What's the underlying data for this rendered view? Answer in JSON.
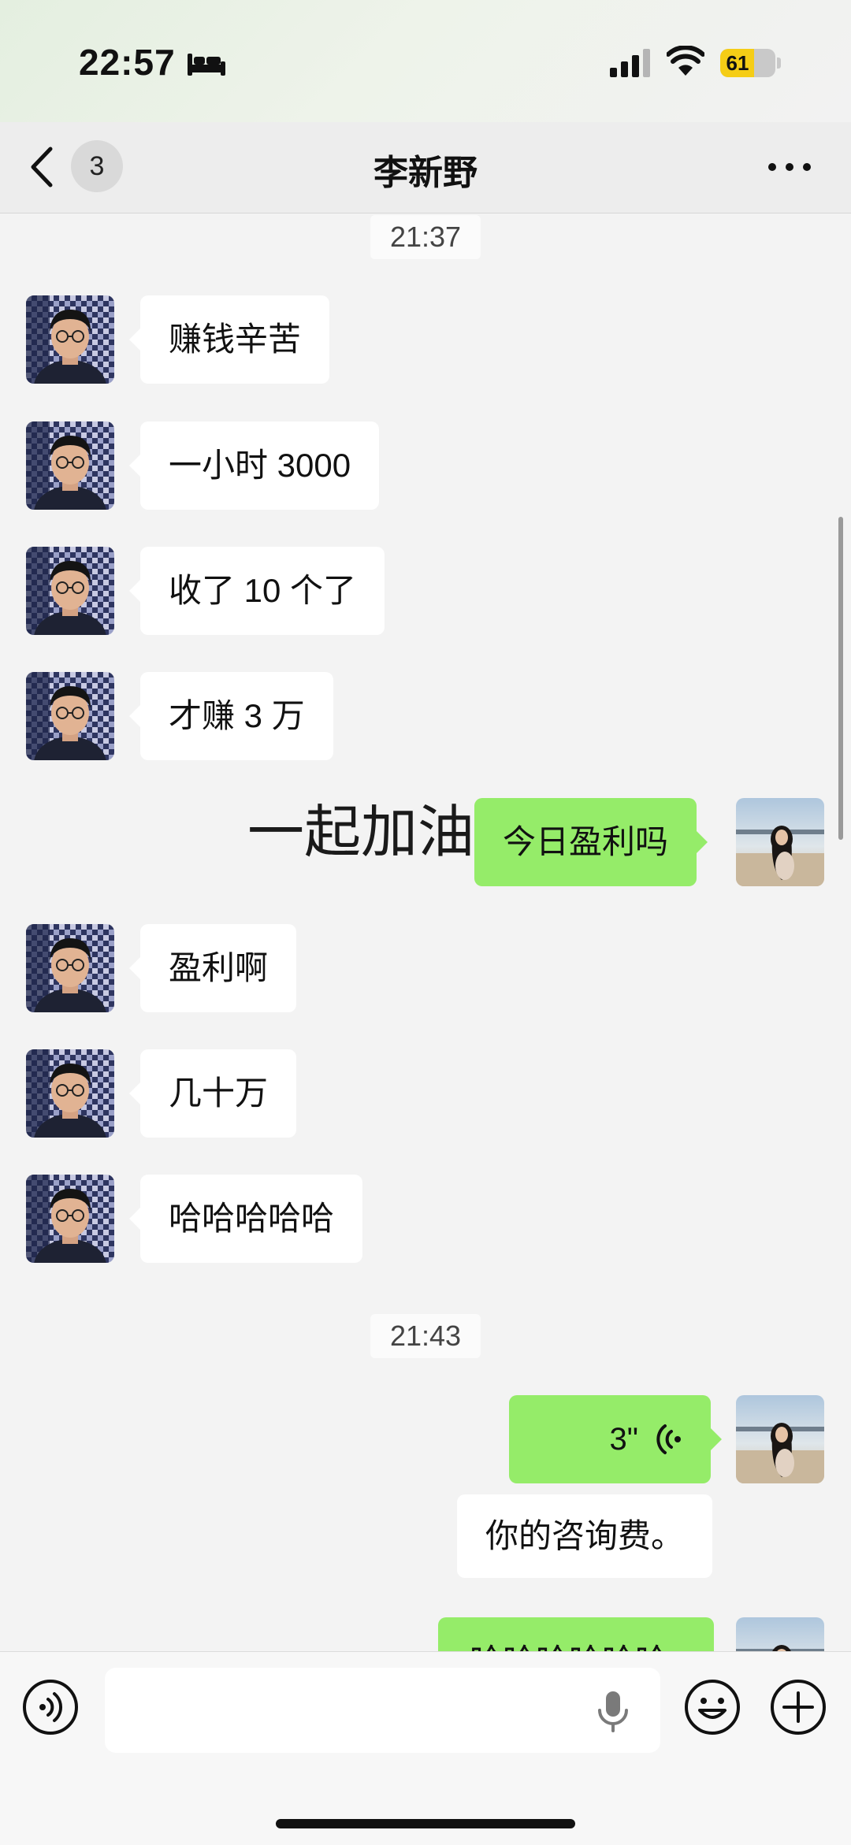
{
  "status_bar": {
    "time": "22:57",
    "battery": "61",
    "battery_level": 0.61
  },
  "nav": {
    "unread_count": "3",
    "title": "李新野"
  },
  "chat": {
    "timestamps": [
      "21:37",
      "21:43"
    ],
    "messages_incoming": [
      "赚钱辛苦",
      "一小时 3000",
      "收了 10 个了",
      "才赚 3 万",
      "盈利啊",
      "几十万",
      "哈哈哈哈哈"
    ],
    "messages_outgoing": [
      "今日盈利吗",
      "你的咨询费。",
      "哈哈哈哈哈哈"
    ],
    "overlay_text": "一起加油",
    "voice_message": {
      "duration": "3\""
    }
  },
  "colors": {
    "outgoing_bubble": "#95ec69",
    "incoming_bubble": "#ffffff",
    "battery": "#f5cd16"
  }
}
